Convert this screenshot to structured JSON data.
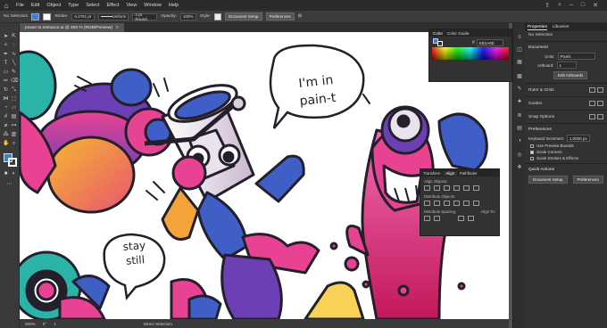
{
  "menubar": {
    "items": [
      "File",
      "Edit",
      "Object",
      "Type",
      "Select",
      "Effect",
      "View",
      "Window",
      "Help"
    ]
  },
  "controlbar": {
    "selection": "No Selection",
    "stroke_label": "Stroke:",
    "stroke_value": "0.4761 pt",
    "uniform": "Uniform",
    "brush": "3 pt. Round",
    "opacity_label": "Opacity:",
    "opacity_value": "100%",
    "style_label": "Style:",
    "document_setup": "Document Setup",
    "preferences": "Preferences"
  },
  "document_tab": {
    "title": "power to entrance.ai @ 200 % (RGB/Preview)",
    "close": "×"
  },
  "statusbar": {
    "zoom": "200%",
    "angle": "0°",
    "page": "1",
    "tool": "Direct Selection"
  },
  "color_panel": {
    "tabs": [
      "Color",
      "Color Guide"
    ],
    "hex": "EB1A6E",
    "hash": "#"
  },
  "align_panel": {
    "tabs": [
      "Transform",
      "Align",
      "Pathfinder"
    ],
    "align_objects": "Align Objects:",
    "distribute_objects": "Distribute Objects:",
    "distribute_spacing": "Distribute Spacing:",
    "align_to": "Align To:"
  },
  "properties_panel": {
    "tabs": [
      "Properties",
      "Libraries"
    ],
    "no_selection": "No Selection",
    "document_header": "Document",
    "units_label": "Units:",
    "units_value": "Pixels",
    "artboard_label": "Artboard:",
    "artboard_value": "1",
    "edit_artboards": "Edit Artboards",
    "rulers_grids": "Ruler & Grids",
    "guides": "Guides",
    "snap_options": "Snap Options",
    "preferences_header": "Preferences",
    "keyboard_increment_label": "Keyboard Increment:",
    "keyboard_increment_value": "1.0000 px",
    "use_preview_bounds": "Use Preview Bounds",
    "scale_corners": "Scale Corners",
    "scale_strokes": "Scale Strokes & Effects",
    "quick_actions": "Quick Actions",
    "document_setup": "Document Setup",
    "preferences": "Preferences"
  },
  "artwork": {
    "bubble1_line1": "I'm in",
    "bubble1_line2": "pain-t",
    "bubble2_line1": "stay",
    "bubble2_line2": "still"
  },
  "colors": {
    "pink": "#e83e8c",
    "purple": "#5b3a8c",
    "orange": "#f4a23a",
    "blue": "#3f5fc7",
    "teal": "#2bb3a8",
    "yellow": "#f7d257"
  }
}
